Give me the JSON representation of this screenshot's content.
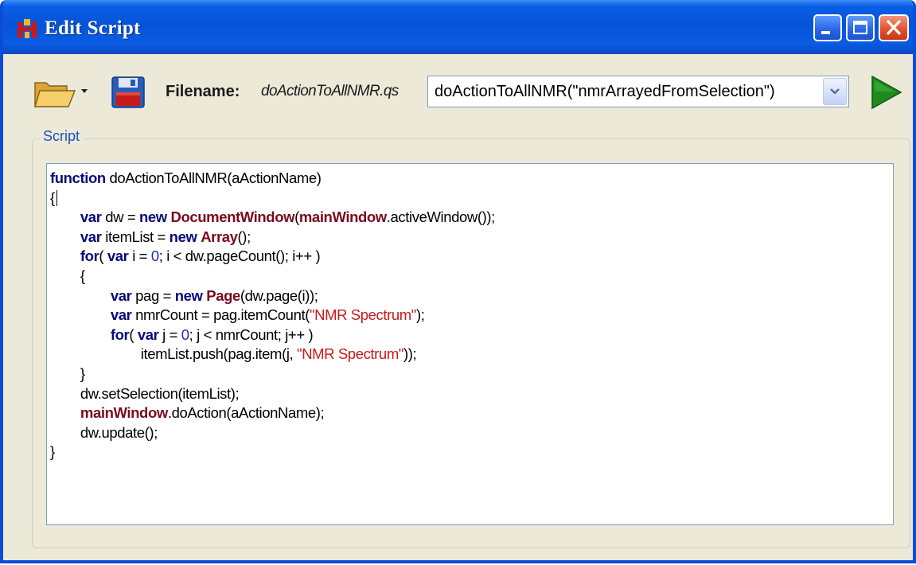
{
  "window": {
    "title": "Edit Script"
  },
  "toolbar": {
    "open_icon": "open-folder-icon",
    "save_icon": "floppy-save-icon",
    "run_icon": "play-icon",
    "filename_label": "Filename:",
    "filename_value": "doActionToAllNMR.qs",
    "function_combo_value": "doActionToAllNMR(\"nmrArrayedFromSelection\")"
  },
  "script_group": {
    "label": "Script"
  },
  "colors": {
    "titlebar": "#0654d8",
    "window_bg": "#ece9d8",
    "keyword": "#0a0a7a",
    "identifier": "#7a0a1e",
    "string": "#c81a1a",
    "group_label": "#1f4fbf",
    "run_green": "#1e8a1e"
  },
  "code_lines": [
    [
      {
        "t": "function",
        "c": "kw"
      },
      {
        "t": " doActionToAllNMR(aActionName)",
        "c": ""
      }
    ],
    [
      {
        "t": "{",
        "c": ""
      },
      {
        "t": "",
        "c": "cursor"
      }
    ],
    [
      {
        "t": "        ",
        "c": ""
      },
      {
        "t": "var",
        "c": "kw"
      },
      {
        "t": " dw = ",
        "c": ""
      },
      {
        "t": "new",
        "c": "kw"
      },
      {
        "t": " ",
        "c": ""
      },
      {
        "t": "DocumentWindow",
        "c": "cls"
      },
      {
        "t": "(",
        "c": ""
      },
      {
        "t": "mainWindow",
        "c": "cls"
      },
      {
        "t": ".activeWindow());",
        "c": ""
      }
    ],
    [
      {
        "t": "        ",
        "c": ""
      },
      {
        "t": "var",
        "c": "kw"
      },
      {
        "t": " itemList = ",
        "c": ""
      },
      {
        "t": "new",
        "c": "kw"
      },
      {
        "t": " ",
        "c": ""
      },
      {
        "t": "Array",
        "c": "cls"
      },
      {
        "t": "();",
        "c": ""
      }
    ],
    [
      {
        "t": "        ",
        "c": ""
      },
      {
        "t": "for",
        "c": "kw"
      },
      {
        "t": "( ",
        "c": ""
      },
      {
        "t": "var",
        "c": "kw"
      },
      {
        "t": " i = ",
        "c": ""
      },
      {
        "t": "0",
        "c": "num"
      },
      {
        "t": "; i < dw.pageCount(); i++ )",
        "c": ""
      }
    ],
    [
      {
        "t": "        {",
        "c": ""
      }
    ],
    [
      {
        "t": "                ",
        "c": ""
      },
      {
        "t": "var",
        "c": "kw"
      },
      {
        "t": " pag = ",
        "c": ""
      },
      {
        "t": "new",
        "c": "kw"
      },
      {
        "t": " ",
        "c": ""
      },
      {
        "t": "Page",
        "c": "cls"
      },
      {
        "t": "(dw.page(i));",
        "c": ""
      }
    ],
    [
      {
        "t": "                ",
        "c": ""
      },
      {
        "t": "var",
        "c": "kw"
      },
      {
        "t": " nmrCount = pag.itemCount(",
        "c": ""
      },
      {
        "t": "\"NMR Spectrum\"",
        "c": "str"
      },
      {
        "t": ");",
        "c": ""
      }
    ],
    [
      {
        "t": "                ",
        "c": ""
      },
      {
        "t": "for",
        "c": "kw"
      },
      {
        "t": "( ",
        "c": ""
      },
      {
        "t": "var",
        "c": "kw"
      },
      {
        "t": " j = ",
        "c": ""
      },
      {
        "t": "0",
        "c": "num"
      },
      {
        "t": "; j < nmrCount; j++ )",
        "c": ""
      }
    ],
    [
      {
        "t": "                        itemList.push(pag.item(j, ",
        "c": ""
      },
      {
        "t": "\"NMR Spectrum\"",
        "c": "str"
      },
      {
        "t": "));",
        "c": ""
      }
    ],
    [
      {
        "t": "        }",
        "c": ""
      }
    ],
    [
      {
        "t": "        dw.setSelection(itemList);",
        "c": ""
      }
    ],
    [
      {
        "t": "        ",
        "c": ""
      },
      {
        "t": "mainWindow",
        "c": "cls"
      },
      {
        "t": ".doAction(aActionName);",
        "c": ""
      }
    ],
    [
      {
        "t": "        dw.update();",
        "c": ""
      }
    ],
    [
      {
        "t": "}",
        "c": ""
      }
    ]
  ]
}
